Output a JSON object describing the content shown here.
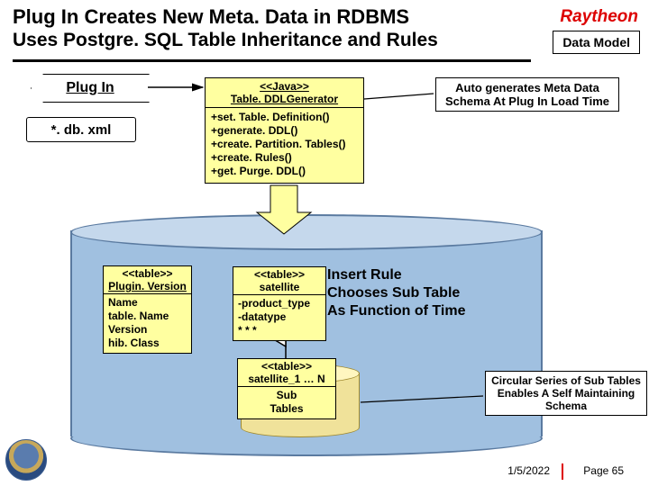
{
  "title": "Plug In Creates New Meta. Data in RDBMS",
  "subtitle": "Uses Postgre. SQL Table Inheritance and Rules",
  "logo": "Raytheon",
  "badge": "Data Model",
  "plugin_label": "Plug In",
  "dbxml_label": "*. db. xml",
  "java": {
    "stereo": "<<Java>>",
    "name": "Table. DDLGenerator",
    "ops": [
      "+set. Table. Definition()",
      "+generate. DDL()",
      "+create. Partition. Tables()",
      "+create. Rules()",
      "+get. Purge. DDL()"
    ]
  },
  "meta_note": "Auto generates Meta Data Schema At Plug In Load Time",
  "plugin_version": {
    "stereo": "<<table>>",
    "name": "Plugin. Version",
    "attrs": [
      "Name",
      "table. Name",
      "Version",
      "hib. Class"
    ]
  },
  "satellite": {
    "stereo": "<<table>>",
    "name": "satellite",
    "attrs": [
      "-product_type",
      "-datatype",
      "* * *"
    ]
  },
  "sub": {
    "stereo": "<<table>>",
    "name": "satellite_1 … N",
    "label1": "Sub",
    "label2": "Tables"
  },
  "big_ann": {
    "l1": "Insert Rule",
    "l2": "Chooses Sub Table",
    "l3": "As Function of Time"
  },
  "circ_note": "Circular Series of Sub Tables Enables A Self Maintaining Schema",
  "footer": {
    "date": "1/5/2022",
    "page_label": "Page",
    "page_num": "65"
  }
}
